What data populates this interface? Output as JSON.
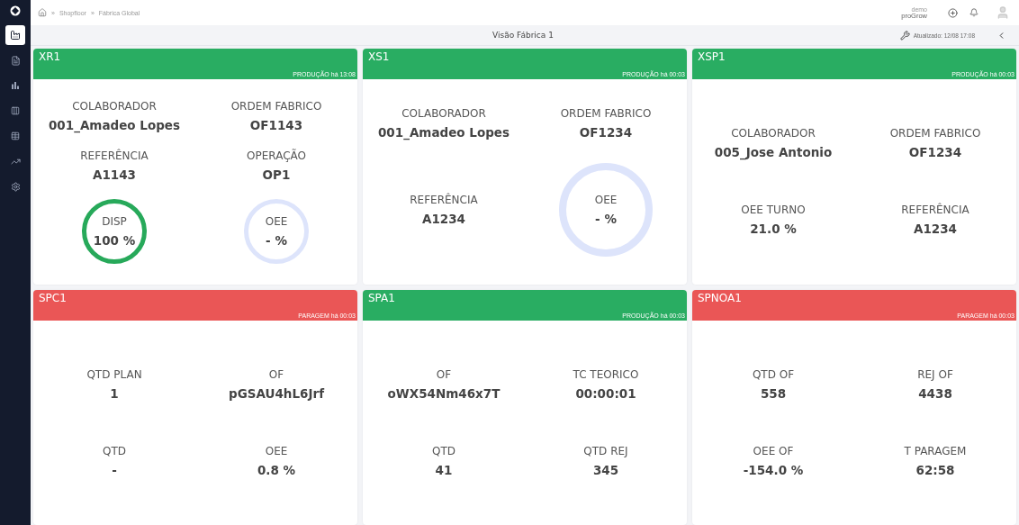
{
  "sidebar": {
    "items": [
      {
        "kind": "factory",
        "selected": true
      },
      {
        "kind": "report",
        "selected": false
      },
      {
        "kind": "bars",
        "selected": false
      },
      {
        "kind": "columns",
        "selected": false
      },
      {
        "kind": "table",
        "selected": false
      },
      {
        "kind": "trend",
        "selected": false
      },
      {
        "kind": "settings",
        "selected": false
      }
    ]
  },
  "breadcrumb": {
    "separator": "»",
    "items": [
      "Shopfloor",
      "Fábrica Global"
    ]
  },
  "user": {
    "name": "demo",
    "company": "proGrow"
  },
  "subheader": {
    "title": "Visão Fábrica 1",
    "updated": "Atualizado: 12/08 17:08"
  },
  "cards": [
    {
      "name": "XR1",
      "color": "#29ad62",
      "status_text": "PRODUÇÃO há 13:08",
      "rows": [
        [
          {
            "kind": "text",
            "label": "COLABORADOR",
            "value": "001_Amadeo Lopes"
          },
          {
            "kind": "text",
            "label": "ORDEM FABRICO",
            "value": "OF1143"
          }
        ],
        [
          {
            "kind": "text",
            "label": "REFERÊNCIA",
            "value": "A1143"
          },
          {
            "kind": "text",
            "label": "OPERAÇÃO",
            "value": "OP1"
          }
        ],
        [
          {
            "kind": "gauge",
            "label": "DISP",
            "value": "100 %",
            "color": "#27a95a"
          },
          {
            "kind": "gauge",
            "label": "OEE",
            "value": "- %",
            "color": "#dde4fb"
          }
        ]
      ]
    },
    {
      "name": "XS1",
      "color": "#29ad62",
      "status_text": "PRODUÇÃO há 00:03",
      "rows": [
        [
          {
            "kind": "text",
            "label": "COLABORADOR",
            "value": "001_Amadeo Lopes"
          },
          {
            "kind": "text",
            "label": "ORDEM FABRICO",
            "value": "OF1234"
          }
        ],
        [
          {
            "kind": "text",
            "label": "REFERÊNCIA",
            "value": "A1234"
          },
          {
            "kind": "gauge",
            "label": "OEE",
            "value": "- %",
            "color": "#dde4fb"
          }
        ]
      ]
    },
    {
      "name": "XSP1",
      "color": "#29ad62",
      "status_text": "PRODUÇÃO há 00:03",
      "rows": [
        [
          {
            "kind": "text",
            "label": "COLABORADOR",
            "value": "005_Jose Antonio"
          },
          {
            "kind": "text",
            "label": "ORDEM FABRICO",
            "value": "OF1234"
          }
        ],
        [
          {
            "kind": "text",
            "label": "OEE TURNO",
            "value": "21.0 %"
          },
          {
            "kind": "text",
            "label": "REFERÊNCIA",
            "value": "A1234"
          }
        ]
      ]
    },
    {
      "name": "SPC1",
      "color": "#ea5656",
      "status_text": "PARAGEM há 00:03",
      "rows": [
        [
          {
            "kind": "text",
            "label": "QTD PLAN",
            "value": "1"
          },
          {
            "kind": "text",
            "label": "OF",
            "value": "pGSAU4hL6Jrf"
          }
        ],
        [
          {
            "kind": "text",
            "label": "QTD",
            "value": "-"
          },
          {
            "kind": "text",
            "label": "OEE",
            "value": "0.8 %"
          }
        ]
      ]
    },
    {
      "name": "SPA1",
      "color": "#29ad62",
      "status_text": "PRODUÇÃO há 00:03",
      "rows": [
        [
          {
            "kind": "text",
            "label": "OF",
            "value": "oWX54Nm46x7T"
          },
          {
            "kind": "text",
            "label": "TC TEORICO",
            "value": "00:00:01"
          }
        ],
        [
          {
            "kind": "text",
            "label": "QTD",
            "value": "41"
          },
          {
            "kind": "text",
            "label": "QTD REJ",
            "value": "345"
          }
        ]
      ]
    },
    {
      "name": "SPNOA1",
      "color": "#ea5656",
      "status_text": "PARAGEM há 00:03",
      "rows": [
        [
          {
            "kind": "text",
            "label": "QTD OF",
            "value": "558"
          },
          {
            "kind": "text",
            "label": "REJ OF",
            "value": "4438"
          }
        ],
        [
          {
            "kind": "text",
            "label": "OEE OF",
            "value": "-154.0 %"
          },
          {
            "kind": "text",
            "label": "T PARAGEM",
            "value": "62:58"
          }
        ]
      ]
    }
  ]
}
